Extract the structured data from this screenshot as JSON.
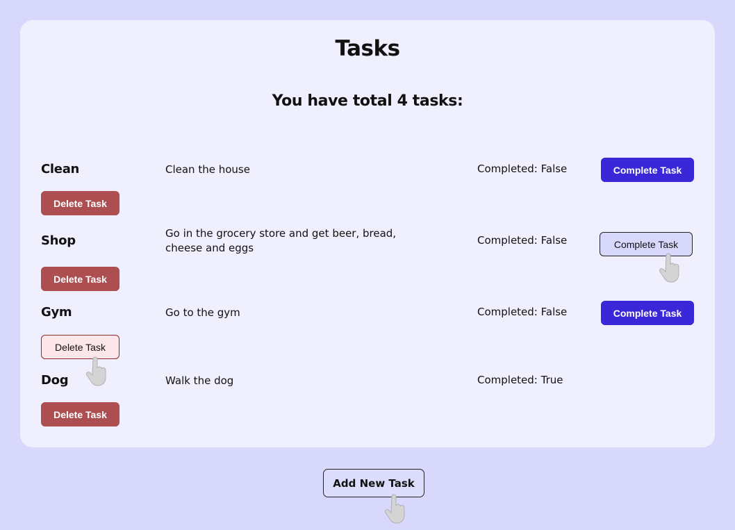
{
  "page": {
    "title": "Tasks",
    "summary": "You have total 4 tasks:"
  },
  "tasks": [
    {
      "name": "Clean",
      "description": "Clean the house",
      "status": "Completed: False",
      "complete_label": "Complete Task",
      "delete_label": "Delete Task"
    },
    {
      "name": "Shop",
      "description": "Go in the grocery store and get beer, bread, cheese and eggs",
      "status": "Completed: False",
      "complete_label": "Complete Task",
      "delete_label": "Delete Task"
    },
    {
      "name": "Gym",
      "description": "Go to the gym",
      "status": "Completed: False",
      "complete_label": "Complete Task",
      "delete_label": "Delete Task"
    },
    {
      "name": "Dog",
      "description": "Walk the dog",
      "status": "Completed: True",
      "delete_label": "Delete Task"
    }
  ],
  "footer": {
    "add_label": "Add New Task"
  },
  "colors": {
    "background": "#d8d8fc",
    "card": "#efeffd",
    "complete_button": "#3a28d8",
    "delete_button": "#ad4e51"
  },
  "icons": {
    "cursor": "hand-pointer-icon"
  }
}
